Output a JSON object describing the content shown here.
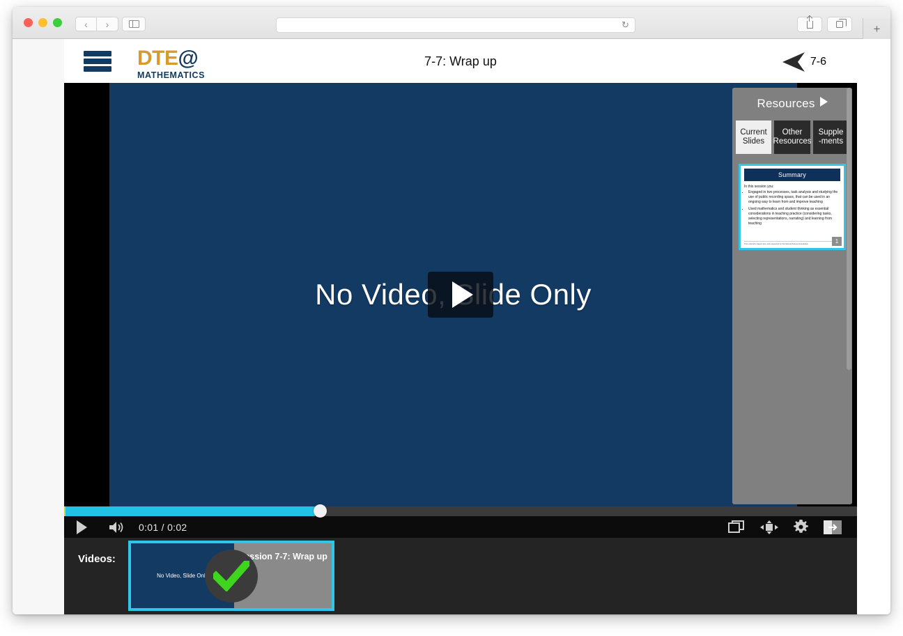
{
  "browser": {
    "traffic_lights": [
      "close",
      "minimize",
      "maximize"
    ],
    "back_label": "‹",
    "forward_label": "›",
    "url_value": "",
    "url_placeholder": "",
    "reload_label": "↻",
    "new_tab_label": "+"
  },
  "app": {
    "title": "7-7: Wrap up",
    "logo_main": "DTE",
    "logo_at": "@",
    "logo_sub": "MATHEMATICS",
    "prev_label": "7-6"
  },
  "stage": {
    "slide_text": "No Video, Slide Only"
  },
  "resources": {
    "title": "Resources",
    "tabs": [
      {
        "label": "Current Slides",
        "line1": "Current",
        "line2": "Slides",
        "active": true
      },
      {
        "label": "Other Resources",
        "line1": "Other",
        "line2": "Resources",
        "active": false
      },
      {
        "label": "Supplements",
        "line1": "Supple",
        "line2": "-ments",
        "active": false
      }
    ],
    "slide_thumb": {
      "banner": "Summary",
      "lead": "In this session you:",
      "bullets": [
        "Engaged in two processes, task analysis and studying the use of public recording space, that can be used in an ongoing way to learn from and improve teaching",
        "Used mathematics and student thinking as essential considerations in teaching practice (considering tasks, selecting representations, narrating) and learning from teaching"
      ],
      "footer": "This material is based upon work supported by the National Science Foundation.",
      "number": "1"
    }
  },
  "controls": {
    "play_label": "play",
    "volume_label": "volume",
    "current_time": "0:01",
    "separator": "/",
    "total_time": "0:02",
    "progress_percent": 31.5,
    "right_icons": [
      "picture-in-picture",
      "move",
      "settings-gear",
      "fullscreen-exit"
    ]
  },
  "videos": {
    "label": "Videos:",
    "items": [
      {
        "thumb_text": "No Video, Slide Only",
        "title": "Session 7-7: Wrap up",
        "completed": true,
        "check_color": "#3fd41e"
      }
    ]
  },
  "colors": {
    "slide_navy": "#123a63",
    "accent_cyan": "#2fc6e8",
    "logo_gold": "#d79b2c",
    "panel_gray": "#808080"
  }
}
